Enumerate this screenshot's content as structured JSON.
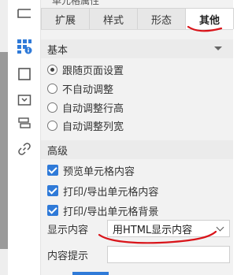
{
  "panel": {
    "title": "单元格属性",
    "tabs": [
      {
        "label": "扩展",
        "active": false
      },
      {
        "label": "样式",
        "active": false
      },
      {
        "label": "形态",
        "active": false
      },
      {
        "label": "其他",
        "active": true
      }
    ]
  },
  "basic": {
    "header": "基本",
    "options": [
      {
        "label": "跟随页面设置",
        "checked": true
      },
      {
        "label": "不自动调整",
        "checked": false
      },
      {
        "label": "自动调整行高",
        "checked": false
      },
      {
        "label": "自动调整列宽",
        "checked": false
      }
    ]
  },
  "advanced": {
    "header": "高级",
    "checks": [
      {
        "label": "预览单元格内容",
        "checked": true
      },
      {
        "label": "打印/导出单元格内容",
        "checked": true
      },
      {
        "label": "打印/导出单元格背景",
        "checked": true
      }
    ],
    "display_content": {
      "label": "显示内容",
      "value": "用HTML显示内容"
    },
    "cell_hint": {
      "label": "内容提示",
      "value": ""
    }
  },
  "rail_icons": [
    "cell-style-icon",
    "grid-settings-icon",
    "border-icon",
    "dropdown-widget-icon",
    "layers-icon",
    "link-icon"
  ],
  "colors": {
    "accent": "#2f7ad8",
    "annotation": "#d9141a"
  }
}
